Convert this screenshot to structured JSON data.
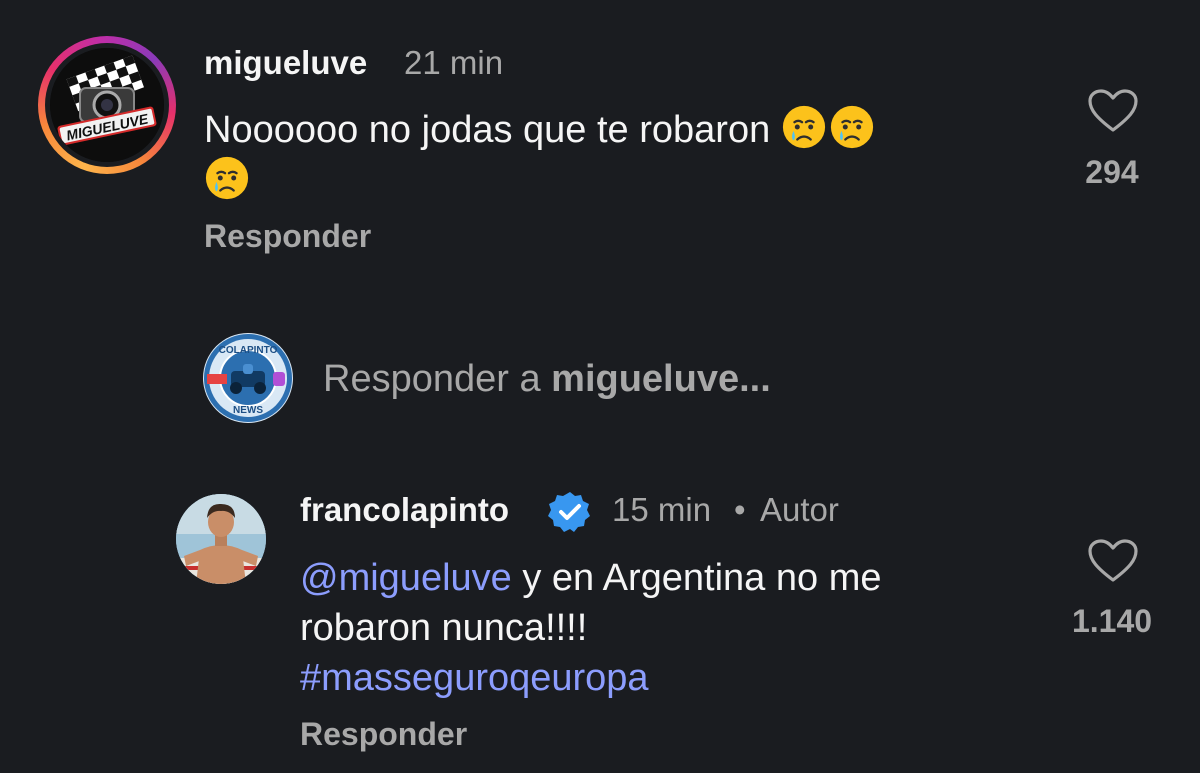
{
  "comments": [
    {
      "username": "migueluve",
      "time": "21 min",
      "text": "Noooooo no jodas que te robaron",
      "emoji_count": 3,
      "reply_label": "Responder",
      "likes": "294",
      "avatar_text": "MIGUELUVE"
    },
    {
      "username": "francolapinto",
      "time": "15 min",
      "separator": "•",
      "author_badge": "Autor",
      "mention_icon": "@",
      "mention": "migueluve",
      "text_line1": " y en Argentina no me",
      "text_line2": "robaron nunca!!!!",
      "hashtag": "#masseguroqeuropa",
      "reply_label": "Responder",
      "likes": "1.140"
    }
  ],
  "composer": {
    "prefix": "Responder a ",
    "target": "migueluve...",
    "avatar_top_text": "COLAPINTO",
    "avatar_bottom_text": "NEWS"
  },
  "icons": {
    "like": "heart-icon",
    "verified": "verified-badge-icon",
    "emoji": "crying-face-emoji"
  },
  "colors": {
    "background": "#1a1c20",
    "text": "#f5f5f5",
    "muted": "#a8a8a8",
    "link": "#8c9dfd",
    "verified": "#3897f0"
  }
}
